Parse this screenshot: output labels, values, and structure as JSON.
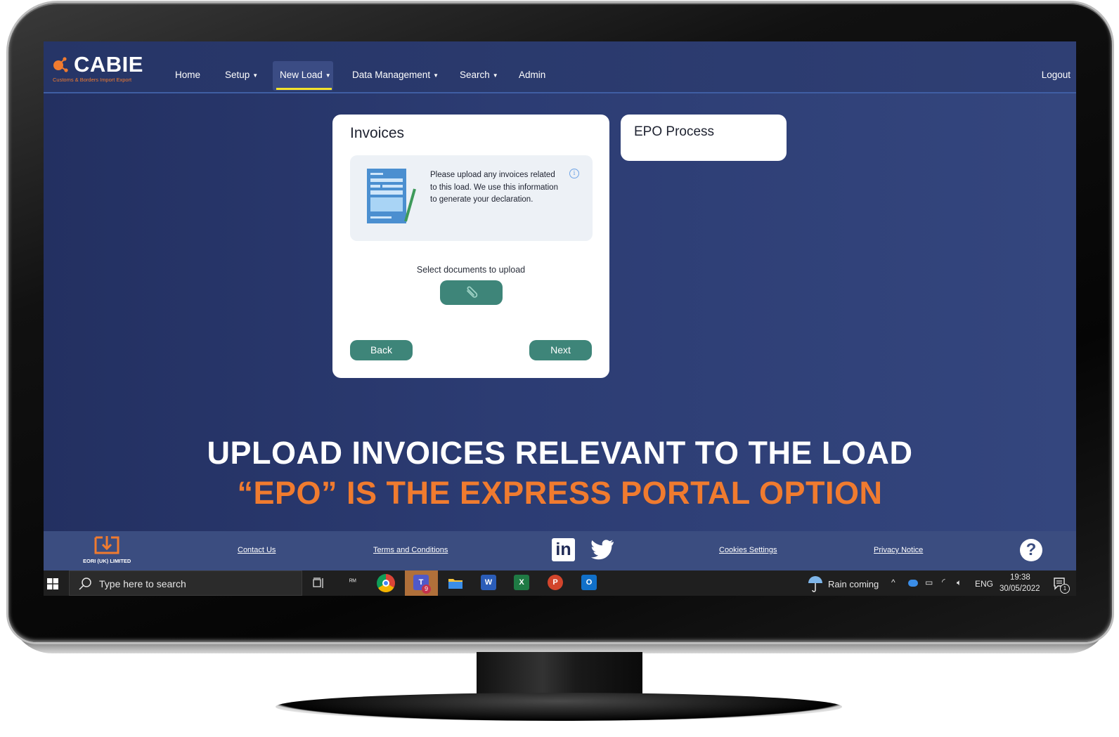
{
  "brand": {
    "name": "CABIE",
    "tagline": "Customs & Borders Import Export"
  },
  "nav": {
    "items": [
      {
        "label": "Home",
        "dropdown": false
      },
      {
        "label": "Setup",
        "dropdown": true
      },
      {
        "label": "New Load",
        "dropdown": true,
        "active": true
      },
      {
        "label": "Data Management",
        "dropdown": true
      },
      {
        "label": "Search",
        "dropdown": true
      },
      {
        "label": "Admin",
        "dropdown": false
      }
    ],
    "logout_label": "Logout"
  },
  "invoices_card": {
    "title": "Invoices",
    "info_text": "Please upload any invoices related to this load. We use this information to generate your declaration.",
    "info_icon": "i",
    "select_label": "Select documents to upload",
    "upload_icon": "paperclip-icon",
    "back_label": "Back",
    "next_label": "Next"
  },
  "epo_card": {
    "title": "EPO Process"
  },
  "headline": {
    "line1": "UPLOAD INVOICES RELEVANT TO THE LOAD",
    "line2": "“EPO” IS THE EXPRESS PORTAL OPTION"
  },
  "footer": {
    "company": "EORI (UK) LIMITED",
    "links": {
      "contact": "Contact Us",
      "terms": "Terms and Conditions",
      "cookies": "Cookies Settings",
      "privacy": "Privacy Notice"
    },
    "social": {
      "linkedin": "in"
    },
    "help_label": "?"
  },
  "taskbar": {
    "search_placeholder": "Type here to search",
    "weather": "Rain coming",
    "language": "ENG",
    "time": "19:38",
    "date": "30/05/2022",
    "notification_count": "1",
    "teams_badge": "9",
    "apps": {
      "teams": "T",
      "word": "W",
      "excel": "X",
      "powerpoint": "P",
      "outlook": "O"
    }
  },
  "colors": {
    "accent_orange": "#f07b2f",
    "nav_underline": "#f3e32b",
    "button_teal": "#3e8579",
    "background_navy": "#2c3c73"
  }
}
